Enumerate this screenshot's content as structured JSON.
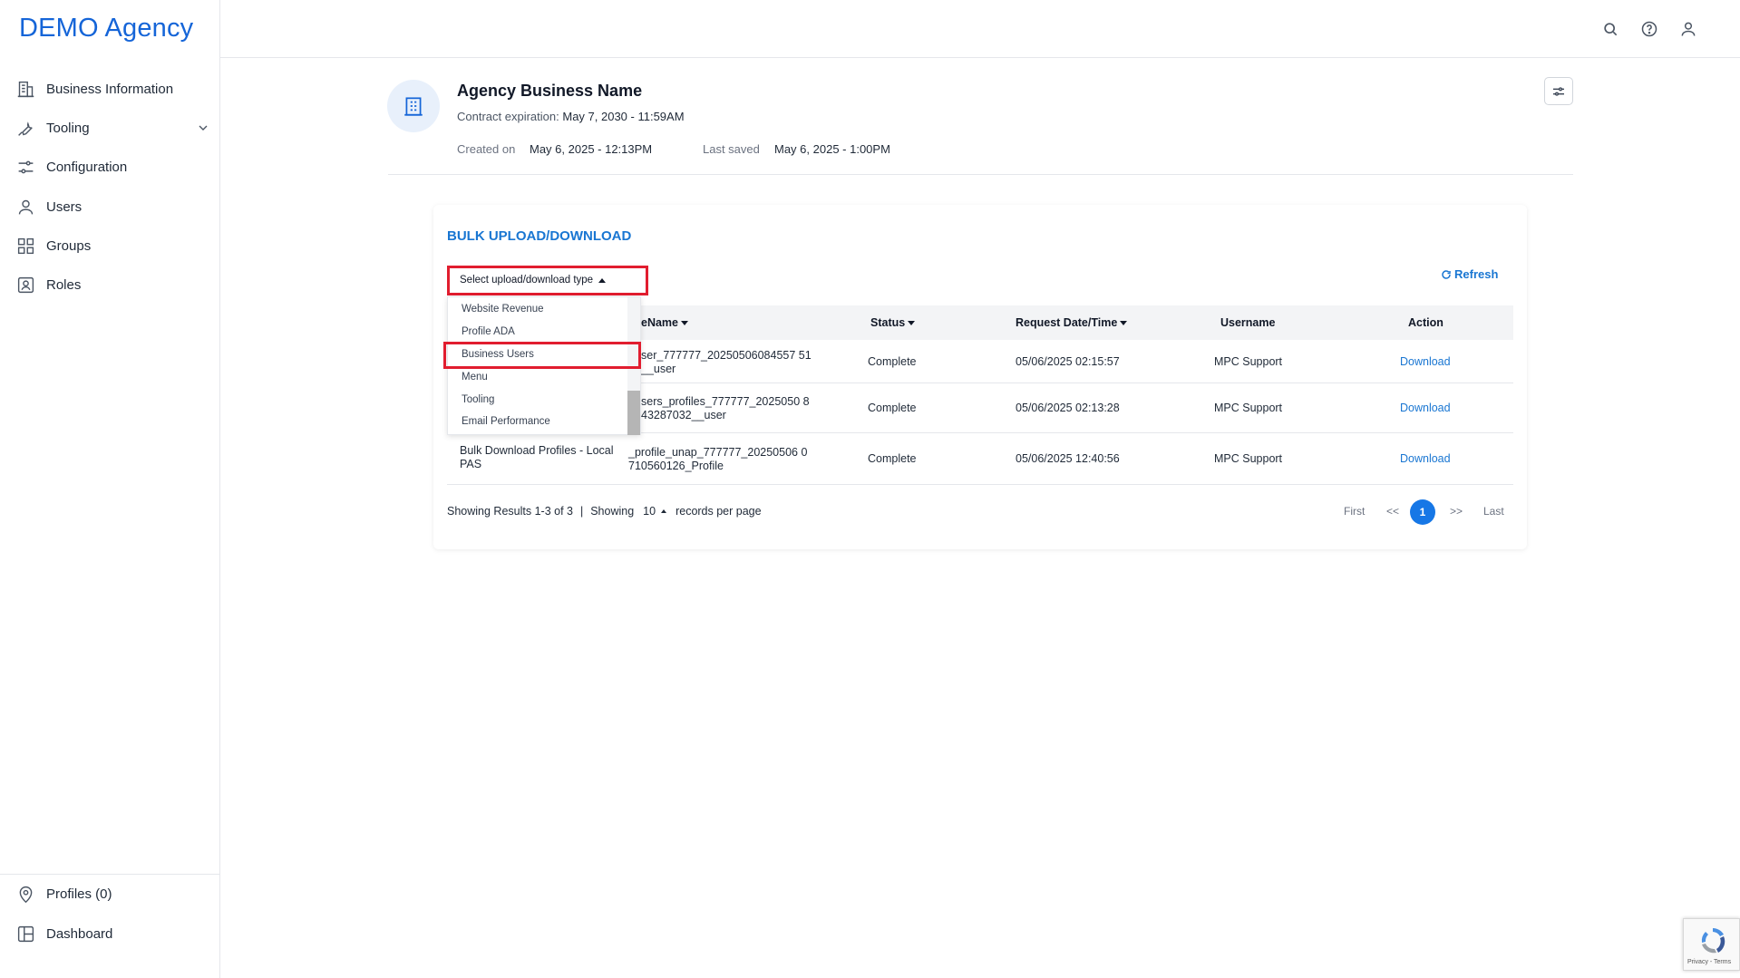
{
  "brand": "DEMO Agency",
  "sidebar": {
    "items": [
      {
        "label": "Business Information",
        "icon": "building-icon"
      },
      {
        "label": "Tooling",
        "icon": "wrench-icon"
      },
      {
        "label": "Configuration",
        "icon": "sliders-icon"
      },
      {
        "label": "Users",
        "icon": "user-icon"
      },
      {
        "label": "Groups",
        "icon": "grid-icon"
      },
      {
        "label": "Roles",
        "icon": "id-badge-icon"
      }
    ],
    "bottom": [
      {
        "label": "Profiles (0)",
        "icon": "location-pin-icon"
      },
      {
        "label": "Dashboard",
        "icon": "layout-icon"
      }
    ]
  },
  "business": {
    "name": "Agency Business Name",
    "contract_label": "Contract expiration:",
    "contract_value": "May 7, 2030 - 11:59AM",
    "created_label": "Created on",
    "created_value": "May 6, 2025 - 12:13PM",
    "saved_label": "Last saved",
    "saved_value": "May 6, 2025 - 1:00PM"
  },
  "bulk": {
    "title": "BULK UPLOAD/DOWNLOAD",
    "select_label": "Select upload/download type",
    "refresh_label": "Refresh",
    "dropdown_options": [
      "Website Revenue",
      "Profile ADA",
      "Business Users",
      "Menu",
      "Tooling",
      "Email Performance"
    ],
    "columns": [
      "eName",
      "Status",
      "Request Date/Time",
      "Username",
      "Action"
    ],
    "rows": [
      {
        "type": "",
        "file": "ser_777777_20250506084557 51__user",
        "status": "Complete",
        "date": "05/06/2025 02:15:57",
        "user": "MPC Support",
        "action": "Download"
      },
      {
        "type": "",
        "file": "sers_profiles_777777_2025050 843287032__user",
        "status": "Complete",
        "date": "05/06/2025 02:13:28",
        "user": "MPC Support",
        "action": "Download"
      },
      {
        "type": "Bulk Download Profiles - Local PAS",
        "file": "_profile_unap_777777_20250506 0710560126_Profile",
        "status": "Complete",
        "date": "05/06/2025 12:40:56",
        "user": "MPC Support",
        "action": "Download"
      }
    ],
    "results_text": "Showing Results 1-3 of 3",
    "separator": "|",
    "showing_label": "Showing",
    "per_page": "10",
    "per_page_suffix": "records per page",
    "pagination": {
      "first": "First",
      "prev": "<<",
      "current": "1",
      "next": ">>",
      "last": "Last"
    }
  },
  "recaptcha": {
    "text": "Privacy - Terms"
  }
}
